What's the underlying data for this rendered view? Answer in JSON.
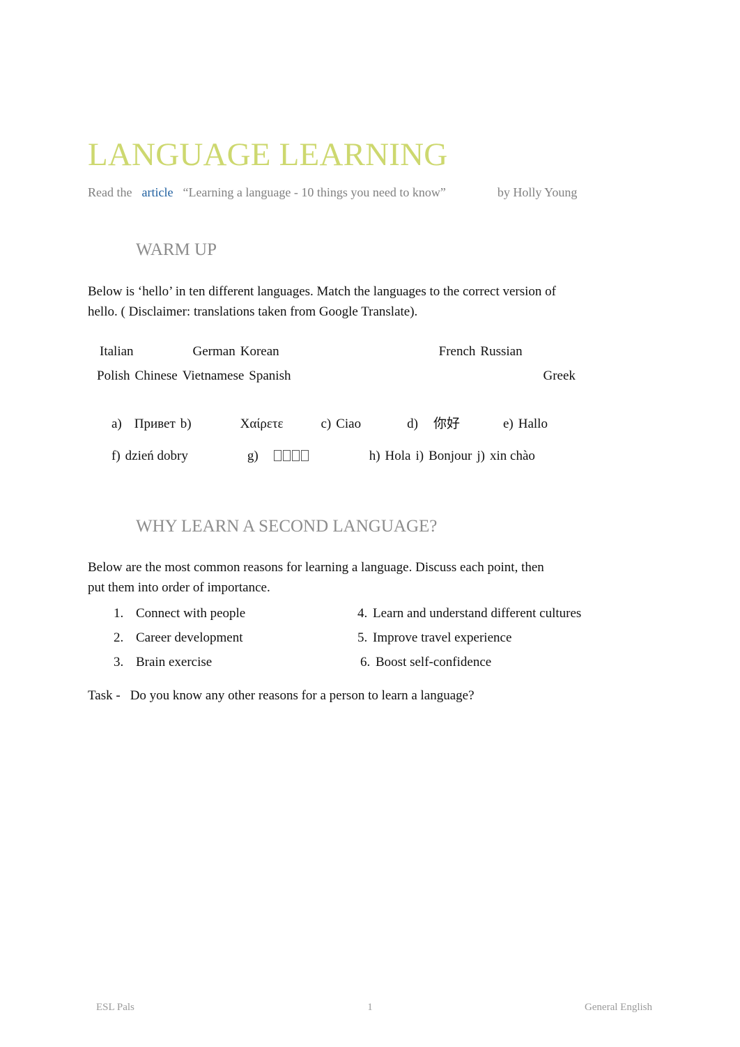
{
  "document": {
    "title": "LANGUAGE LEARNING",
    "subtitle": {
      "lead": "Read the",
      "link_text": "article",
      "quote": "“Learning a language - 10 things you need to know”",
      "byline": "by Holly Young"
    }
  },
  "sections": {
    "warm_up": {
      "heading": "WARM UP",
      "instruction_line_1": "Below is ‘hello’ in ten different languages. Match the languages to the correct version of",
      "instruction_line_2": "hello. (  Disclaimer: translations taken from Google Translate).",
      "language_rows": [
        {
          "a": "Italian",
          "b": "German",
          "c": "Korean",
          "d": "French",
          "e": "Russian"
        },
        {
          "a": "Polish",
          "b": "Chinese",
          "c": "Vietnamese",
          "d": "Spanish",
          "e": "Greek"
        }
      ],
      "options_row_1": [
        {
          "label": "a)",
          "value": "Привет"
        },
        {
          "label": "b)",
          "value": "Χαίρετε"
        },
        {
          "label": "c)",
          "value": "Ciao"
        },
        {
          "label": "d)",
          "value": "你好"
        },
        {
          "label": "e)",
          "value": "Hallo"
        }
      ],
      "options_row_2": [
        {
          "label": "f)",
          "value": "dzień dobry"
        },
        {
          "label": "g)",
          "value": "⬜⬜⬜⬜"
        },
        {
          "label": "h)",
          "value": "Hola"
        },
        {
          "label": "i)",
          "value": "Bonjour"
        },
        {
          "label": "j)",
          "value": "xin chào"
        }
      ]
    },
    "why_learn": {
      "heading": "WHY LEARN A SECOND LANGUAGE?",
      "instruction_line_1": "Below are the most common reasons for learning a language. Discuss each point, then",
      "instruction_line_2": "put them into order of importance.",
      "reasons_left": [
        {
          "num": "1.",
          "text": "Connect with people"
        },
        {
          "num": "2.",
          "text": "Career development"
        },
        {
          "num": "3.",
          "text": "Brain exercise"
        }
      ],
      "reasons_right": [
        {
          "num": "4.",
          "text": "Learn and understand different cultures"
        },
        {
          "num": "5.",
          "text": "Improve travel experience"
        },
        {
          "num": "6.",
          "text": "Boost self-confidence"
        }
      ],
      "task_label": "Task -",
      "task_text": "Do you know any other reasons for a person to learn a language?"
    }
  },
  "footer": {
    "left": "ESL Pals",
    "page_number": "1",
    "right": "General English"
  },
  "colors": {
    "title": "#cdd86f",
    "heading": "#8c8c8c",
    "link": "#2060a0",
    "subtitle": "#808080",
    "footer": "#9a9a9a",
    "body": "#101010"
  }
}
